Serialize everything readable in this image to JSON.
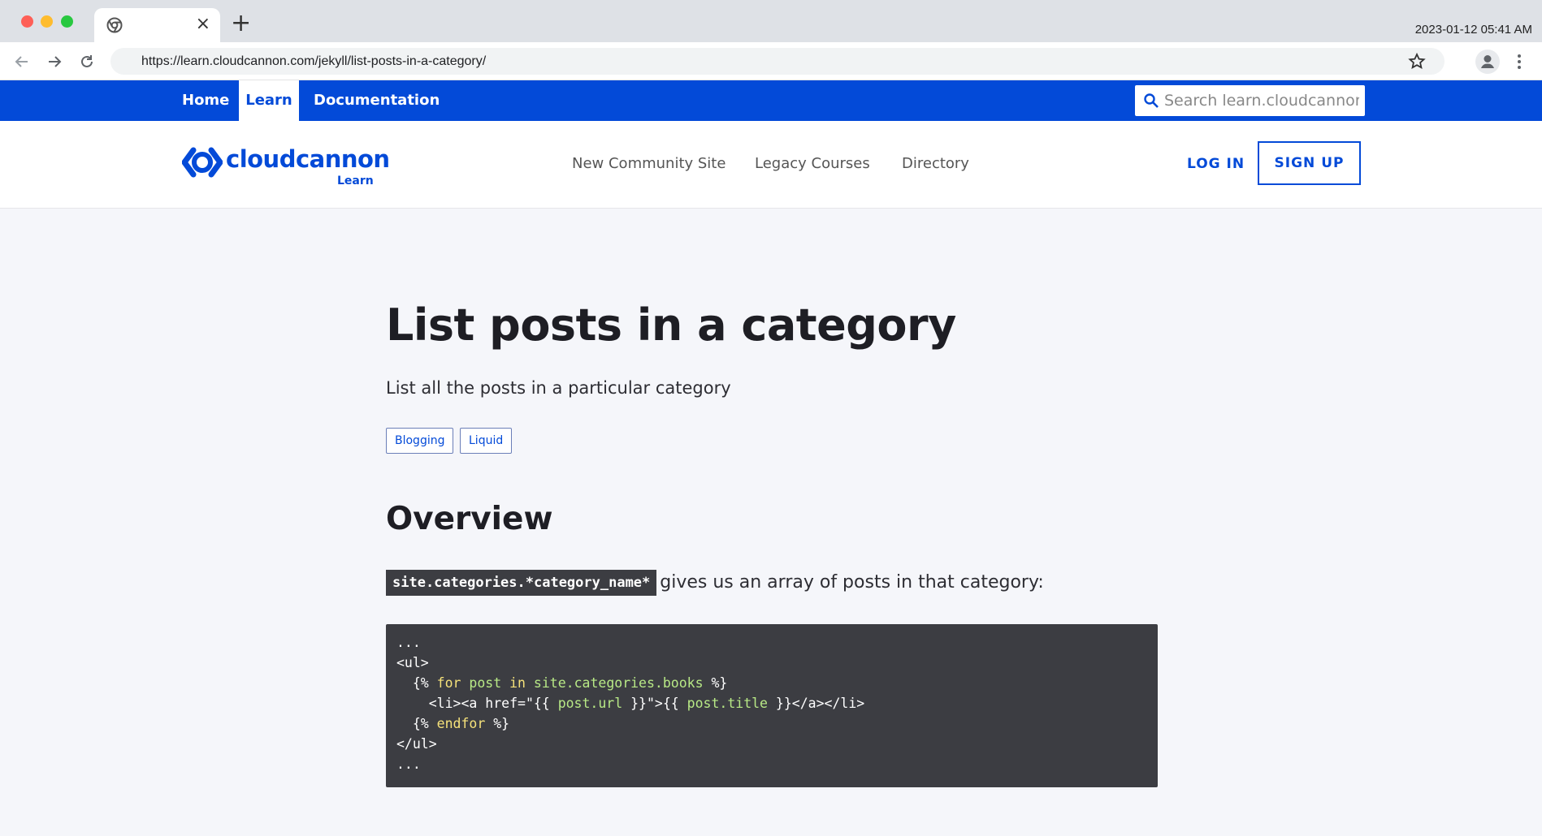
{
  "browser": {
    "datetime": "2023-01-12 05:41 AM",
    "url": "https://learn.cloudcannon.com/jekyll/list-posts-in-a-category/",
    "new_tab_label": "+",
    "close_tab_label": "×"
  },
  "topbar": {
    "links": [
      "Home",
      "Learn",
      "Documentation"
    ],
    "active": "Learn",
    "search_placeholder": "Search learn.cloudcannon.com"
  },
  "header": {
    "logo_word": "cloudcannon",
    "logo_sub": "Learn",
    "nav": [
      "New Community Site",
      "Legacy Courses",
      "Directory"
    ],
    "login": "LOG IN",
    "signup": "SIGN UP"
  },
  "article": {
    "title": "List posts in a category",
    "lead": "List all the posts in a particular category",
    "tags": [
      "Blogging",
      "Liquid"
    ],
    "section_heading": "Overview",
    "inline_code": "site.categories.*category_name*",
    "paragraph": "gives us an array of posts in that category:",
    "code": {
      "line1": "...",
      "line2": "<ul>",
      "line3": {
        "open": "  {% ",
        "kw1": "for",
        "s1": " ",
        "var1": "post",
        "s2": " ",
        "kw2": "in",
        "s3": " ",
        "var2": "site.categories.books",
        "close": " %}"
      },
      "line4": {
        "a": "    <li><a href=\"{{ ",
        "var1": "post.url",
        "b": " }}\">{{ ",
        "var2": "post.title",
        "c": " }}</a></li>"
      },
      "line5": {
        "open": "  {% ",
        "kw": "endfor",
        "close": " %}"
      },
      "line6": "</ul>",
      "line7": "..."
    }
  },
  "colors": {
    "brand_blue": "#034ad8",
    "code_bg": "#3c3d42",
    "code_keyword": "#f6e27a",
    "code_variable": "#b8e986"
  },
  "icons": [
    "chrome-icon",
    "back-arrow-icon",
    "forward-arrow-icon",
    "reload-icon",
    "star-icon",
    "profile-icon",
    "kebab-menu-icon",
    "search-icon",
    "cloudcannon-logo-icon"
  ]
}
